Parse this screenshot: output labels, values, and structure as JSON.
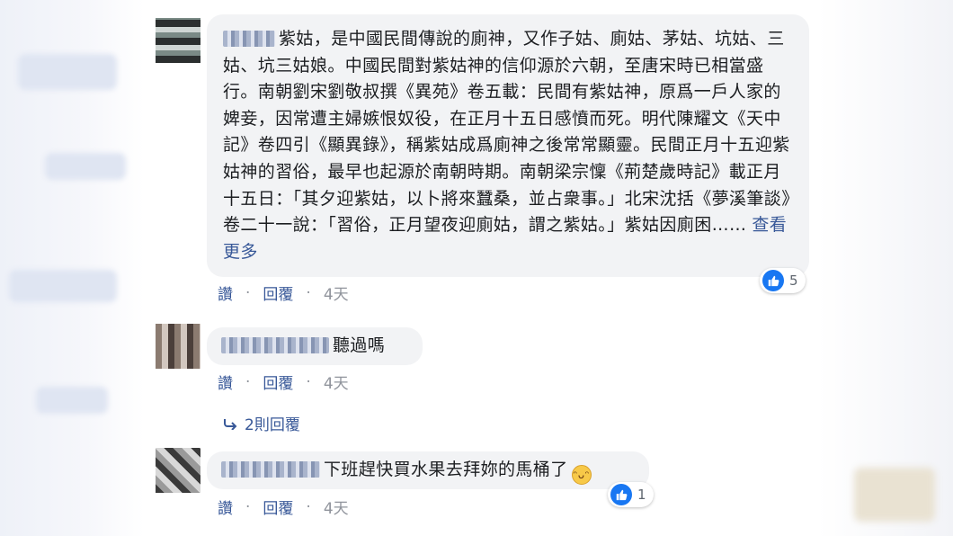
{
  "comments": [
    {
      "text": "紫姑，是中國民間傳說的廁神，又作子姑、廁姑、茅姑、坑姑、三姑、坑三姑娘。中國民間對紫姑神的信仰源於六朝，至唐宋時已相當盛行。南朝劉宋劉敬叔撰《異苑》卷五載：民間有紫姑神，原爲一戶人家的婢妾，因常遭主婦嫉恨奴役，在正月十五日感憤而死。明代陳耀文《天中記》卷四引《顯異錄》，稱紫姑成爲廁神之後常常顯靈。民間正月十五迎紫姑神的習俗，最早也起源於南朝時期。南朝梁宗懍《荊楚歲時記》載正月十五日：「其夕迎紫姑，以卜將來蠶桑，並占衆事。」北宋沈括《夢溪筆談》卷二十一說：「習俗，正月望夜迎廁姑，謂之紫姑。」紫姑因廁困……",
      "see_more": "查看更多",
      "like_label": "讚",
      "reply_label": "回覆",
      "time": "4天",
      "reaction_count": "5"
    },
    {
      "text": "聽過嗎",
      "like_label": "讚",
      "reply_label": "回覆",
      "time": "4天"
    },
    {
      "text": "下班趕快買水果去拜妳的馬桶了",
      "emoji": "laughing-emoji",
      "like_label": "讚",
      "reply_label": "回覆",
      "time": "4天",
      "reaction_count": "1"
    }
  ],
  "replies_link": "2則回覆",
  "colors": {
    "link": "#385898",
    "bubble": "#f2f3f5",
    "like_blue": "#1877f2",
    "meta_gray": "#90949c"
  }
}
